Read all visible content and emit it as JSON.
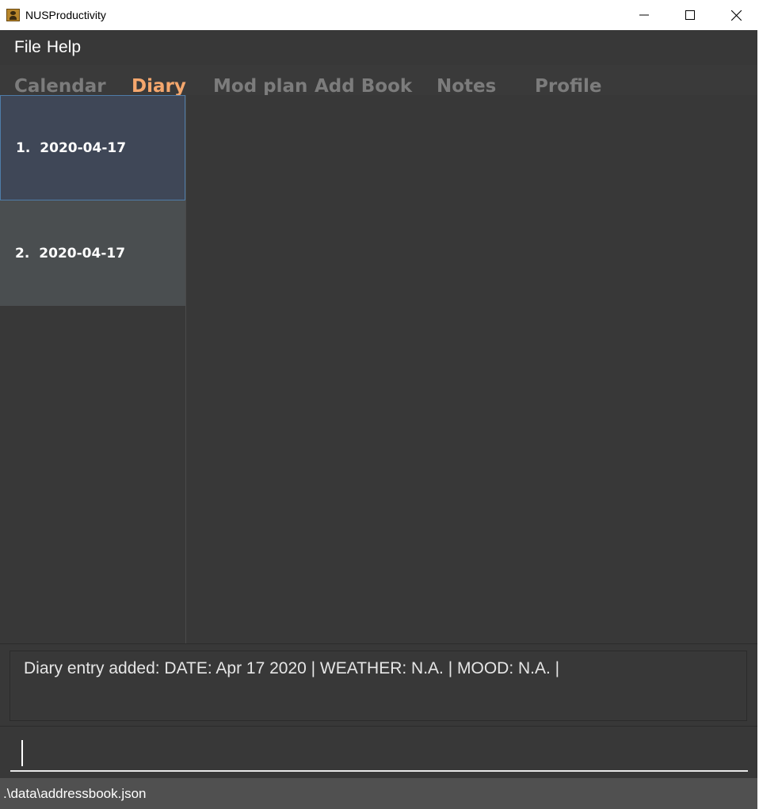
{
  "window": {
    "title": "NUSProductivity",
    "icon": "address-book-icon",
    "controls": [
      "minimize-icon",
      "maximize-icon",
      "close-icon"
    ]
  },
  "menu": {
    "items": [
      {
        "label": "File"
      },
      {
        "label": "Help"
      }
    ]
  },
  "tabs": {
    "items": [
      {
        "label": "Calendar",
        "active": false
      },
      {
        "label": "Diary",
        "active": true
      },
      {
        "label": "Mod plan",
        "active": false
      },
      {
        "label": "Add Book",
        "active": false
      },
      {
        "label": "Notes",
        "active": false
      },
      {
        "label": "Profile",
        "active": false
      }
    ]
  },
  "diary": {
    "entries": [
      {
        "index": "1.",
        "date": "2020-04-17",
        "selected": true
      },
      {
        "index": "2.",
        "date": "2020-04-17",
        "selected": false
      }
    ]
  },
  "result": {
    "text": "Diary entry added: DATE: Apr 17 2020 | WEATHER: N.A. | MOOD: N.A. |"
  },
  "command": {
    "value": "",
    "placeholder": ""
  },
  "status": {
    "file_path": ".\\data\\addressbook.json"
  },
  "colors": {
    "background": "#383838",
    "active_tab": "#f5a76d",
    "inactive_tab": "#7c7c7c",
    "selected_cell": "#3f4757",
    "selected_cell_border": "#4e7ca8",
    "cell": "#4a4e50",
    "status_bar": "#505050"
  }
}
